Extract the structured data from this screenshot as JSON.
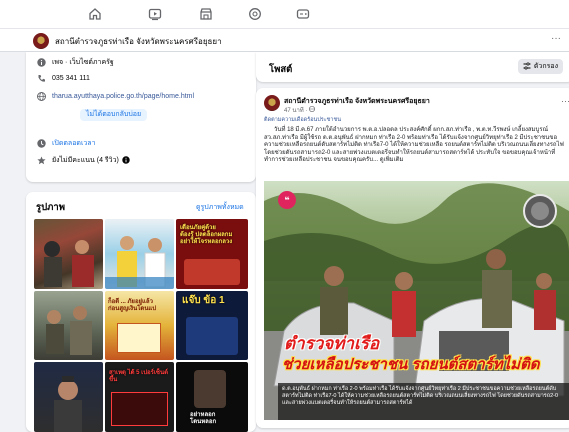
{
  "nav": {
    "items": [
      {
        "name": "home-icon"
      },
      {
        "name": "video-icon"
      },
      {
        "name": "marketplace-icon"
      },
      {
        "name": "gaming-icon"
      },
      {
        "name": "groups-icon"
      }
    ]
  },
  "page": {
    "name": "สถานีตำรวจภูธรท่าเรือ จังหวัดพระนครศรีอยุธยา",
    "more": "···"
  },
  "intro": {
    "category": "เพจ · เว็บไซต์ภาครัฐ",
    "phone": "035 341 111",
    "website": "tharua.ayutthaya.police.go.th/page/home.html",
    "cta": "ไม่ได้ตอบกลับบ่อย",
    "hours": "เปิดตลอดเวลา",
    "rating": "ยังไม่มีคะแนน (4 รีวิว)"
  },
  "photos": {
    "title": "รูปภาพ",
    "see_all": "ดูรูปภาพทั้งหมด",
    "thumbs": [
      {
        "text": ""
      },
      {
        "text": ""
      },
      {
        "text": "เตือนภัยคู่ด้วย\nต้องรู้ ปลดล็อกผลกม\nอย่าให้โจรหลอกลวง"
      },
      {
        "text": ""
      },
      {
        "text": "ก็อดี ... ภัยอยู่แล้ว\nก่อนสูญเงินโดนแป"
      },
      {
        "text": "แจ๊บ ข้อ 1"
      },
      {
        "text": ""
      },
      {
        "text": "สาเหตุ ได้ 5 เปอร์เซ็นต์ขึ้น"
      },
      {
        "text": "อย่าหลอก\nโดนหลอก"
      }
    ]
  },
  "posts": {
    "title": "โพสต์",
    "filter_label": "ตัวกรอง",
    "author": "สถานีตำรวจภูธรท่าเรือ จังหวัดพระนครศรีอยุธยา",
    "time": "47 นาที · ",
    "tag": "ติดตามความเดือดร้อนประชาชน",
    "body": "วันที่ 18 มี.ค.67 ภายใต้อำนวยการ พ.ต.อ.ปลอดล  ประสงค์ศักดิ์ ผกก.สภ.ท่าเรือ , พ.ต.ท.วีรพงษ์ เกลี้ยงสมบูรณ์ สว.สภ.ท่าเรือ  มีผู้ใช้รถ ด.ต.อนุพันธ์ ฝากหมก ท่าเรือ 2-0  พร้อมท่าเรือ ได้รับแจ้งจากศูนย์วิทยุท่าเรือ 2 มีประชาชนขอความช่วยเหลือรถยนต์ดับสตาร์ทไม่ติด ท่าเรือ7-0 ได้ให้ความช่วยเหลือ รถยนต์สตาร์ทไม่ติด บริเวณถนนเลี่ยงทางรถไฟ โดยช่วยดันรถสามารถ2-0 และสายพ่วงแบตเตอรี่จนทำให้รถยนต์สามารถสตาร์ทได้ ประทับใจ ขอขอบคุณเจ้าหน้าที่ ทำการช่วยเหลือประชาชน จนขอบคุณครับ... ดูเพิ่มเติม",
    "see_more": "ดูเพิ่มเติม",
    "headline_1": "ตำรวจท่าเรือ",
    "headline_2": "ช่วยเหลือประชาชน รถยนต์สตาร์ทไม่ติด",
    "caption": "ด.ต.อนุพันธ์ ฝากหมก ท่าเรือ 2-0 พร้อมท่าเรือ ได้รับแจ้งจากศูนย์วิทยุท่าเรือ 2 มีประชาชนขอความช่วยเหลือรถยนต์ดับสตาร์ทไม่ติด ท่าเรือ7-0 ได้ให้ความช่วยเหลือรถยนต์สตาร์ทไม่ติด บริเวณถนนเลี่ยงทางรถไฟ โดยช่วยดันรถสามารถ2-0 และสายพ่วงแบตเตอรี่จนทำให้รถยนต์สามารถสตาร์ทได้"
  },
  "colors": {
    "accent": "#1b74e4",
    "bg": "#f0f2f5",
    "headline_red": "#e21b1b"
  }
}
